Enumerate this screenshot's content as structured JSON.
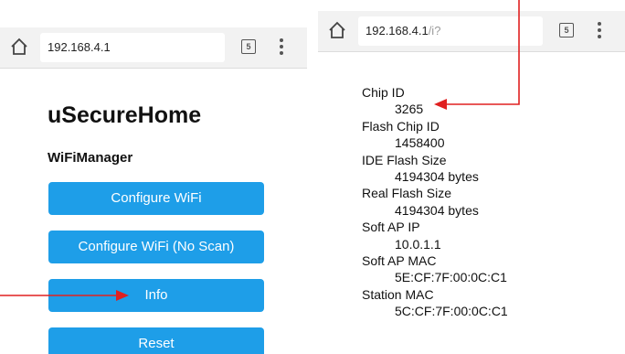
{
  "left_screen": {
    "url": "192.168.4.1",
    "tab_count": "5",
    "title": "uSecureHome",
    "subtitle": "WiFiManager",
    "buttons": [
      "Configure WiFi",
      "Configure WiFi (No Scan)",
      "Info",
      "Reset"
    ]
  },
  "right_screen": {
    "url_host": "192.168.4.1",
    "url_path": "/i?",
    "tab_count": "5",
    "info": [
      {
        "label": "Chip ID",
        "value": "3265"
      },
      {
        "label": "Flash Chip ID",
        "value": "1458400"
      },
      {
        "label": "IDE Flash Size",
        "value": "4194304 bytes"
      },
      {
        "label": "Real Flash Size",
        "value": "4194304 bytes"
      },
      {
        "label": "Soft AP IP",
        "value": "10.0.1.1"
      },
      {
        "label": "Soft AP MAC",
        "value": "5E:CF:7F:00:0C:C1"
      },
      {
        "label": "Station MAC",
        "value": "5C:CF:7F:00:0C:C1"
      }
    ]
  },
  "colors": {
    "button": "#1e9ee8",
    "arrow": "#e02020"
  },
  "icons": [
    "home-icon",
    "tab-switcher-icon",
    "overflow-menu-icon",
    "annotation-arrow"
  ]
}
